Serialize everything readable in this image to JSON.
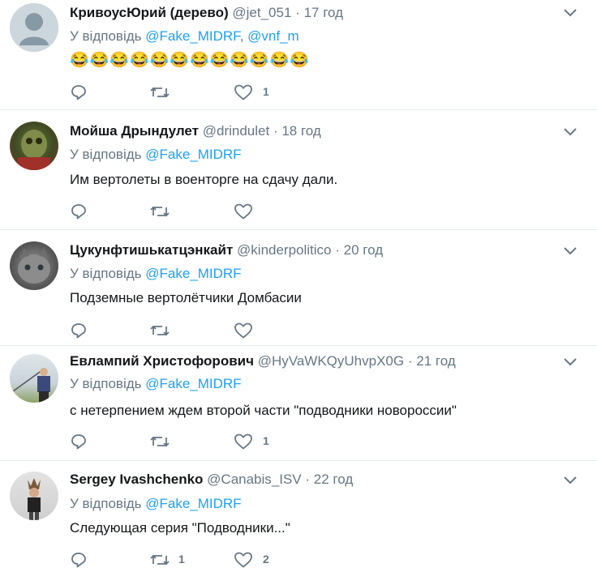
{
  "reply_prefix": "У відповідь",
  "tweets": [
    {
      "name": "КривоусЮрий (дерево)",
      "handle": "@jet_051",
      "time": "17 год",
      "mentions": [
        "@Fake_MIDRF",
        "@vnf_m"
      ],
      "text": "😂😂😂😂😂😂😂😂😂😂😂😂",
      "retweets": "",
      "likes": "1"
    },
    {
      "name": "Мойша Дрындулет",
      "handle": "@drindulet",
      "time": "18 год",
      "mentions": [
        "@Fake_MIDRF"
      ],
      "text": "Им вертолеты в военторге на сдачу дали.",
      "retweets": "",
      "likes": ""
    },
    {
      "name": "Цукунфтишькатцэнкайт",
      "handle": "@kinderpolitico",
      "time": "20 год",
      "mentions": [
        "@Fake_MIDRF"
      ],
      "text": "Подземные вертолётчики Домбасии",
      "retweets": "",
      "likes": ""
    },
    {
      "name": "Евлампий Христофорович",
      "handle": "@HyVaWKQyUhvpX0G",
      "time": "21 год",
      "mentions": [
        "@Fake_MIDRF"
      ],
      "text": "с нетерпением ждем второй части \"подводники новороссии\"",
      "retweets": "",
      "likes": "1"
    },
    {
      "name": "Sergey Ivashchenko",
      "handle": "@Canabis_ISV",
      "time": "22 год",
      "mentions": [
        "@Fake_MIDRF"
      ],
      "text": "Следующая серия \"Подводники...\"",
      "retweets": "1",
      "likes": "2"
    }
  ],
  "icons": {
    "reply": "reply-icon",
    "retweet": "retweet-icon",
    "like": "heart-icon",
    "caret": "chevron-down-icon"
  },
  "colors": {
    "mention": "#1da1f2",
    "secondary": "#657786",
    "divider": "#e6ecf0"
  }
}
